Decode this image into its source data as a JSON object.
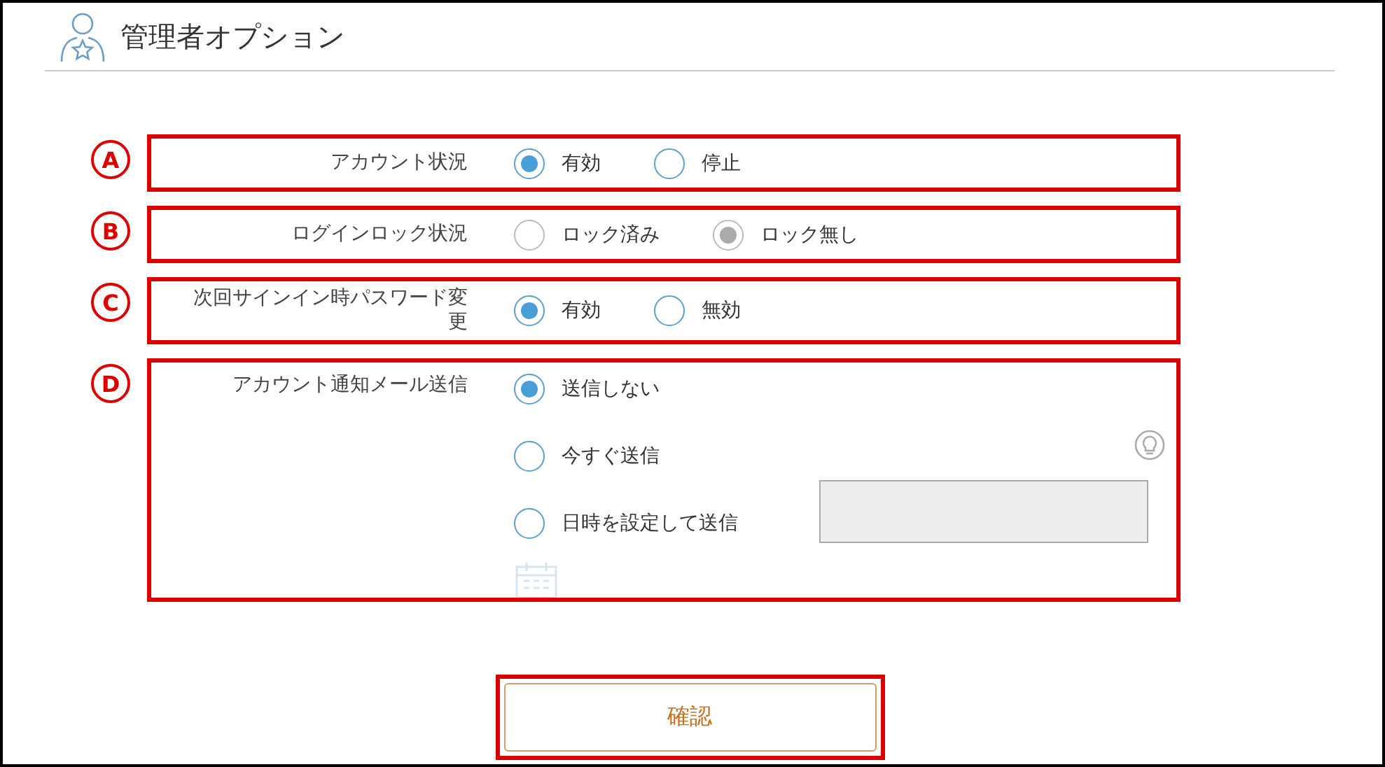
{
  "title": "管理者オプション",
  "rows": [
    {
      "marker": "A",
      "label": "アカウント状況",
      "kind": "inline",
      "disabled": false,
      "options": [
        {
          "label": "有効",
          "selected": true
        },
        {
          "label": "停止",
          "selected": false
        }
      ]
    },
    {
      "marker": "B",
      "label": "ログインロック状況",
      "kind": "inline",
      "disabled": true,
      "options": [
        {
          "label": "ロック済み",
          "selected": false
        },
        {
          "label": "ロック無し",
          "selected": true
        }
      ]
    },
    {
      "marker": "C",
      "label": "次回サインイン時パスワード変更",
      "kind": "inline",
      "disabled": false,
      "options": [
        {
          "label": "有効",
          "selected": true
        },
        {
          "label": "無効",
          "selected": false
        }
      ]
    },
    {
      "marker": "D",
      "label": "アカウント通知メール送信",
      "kind": "vertical",
      "disabled": false,
      "options": [
        {
          "label": "送信しない",
          "selected": true
        },
        {
          "label": "今すぐ送信",
          "selected": false
        },
        {
          "label": "日時を設定して送信",
          "selected": false
        }
      ],
      "datetime_field": {
        "disabled": true
      }
    }
  ],
  "confirm_button": {
    "label": "確認",
    "highlighted": true
  }
}
